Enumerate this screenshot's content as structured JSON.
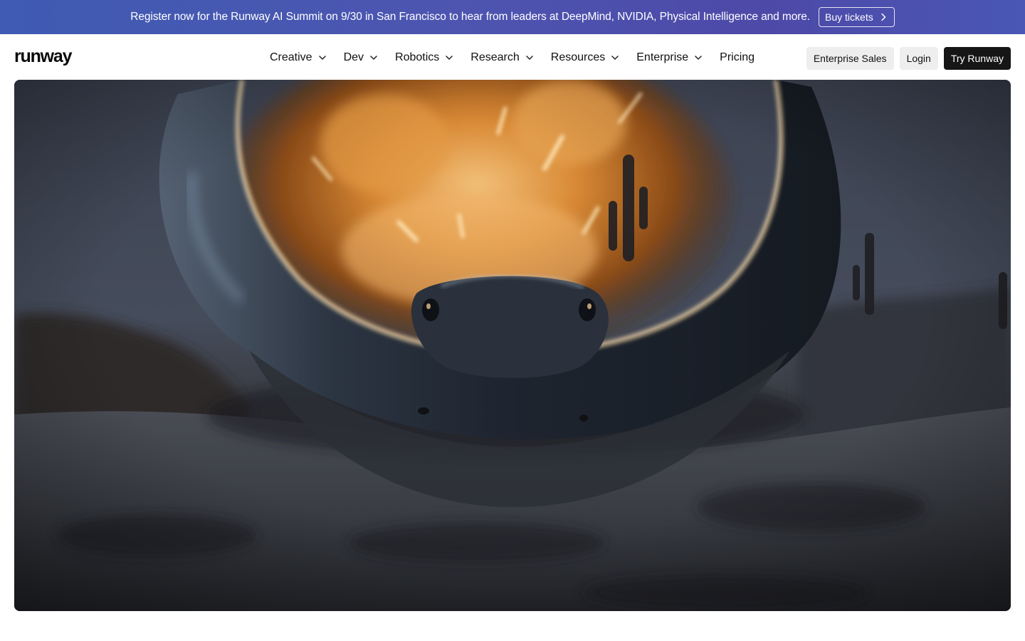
{
  "banner": {
    "text": "Register now for the Runway AI Summit on 9/30 in San Francisco to hear from leaders at DeepMind, NVIDIA, Physical Intelligence and more.",
    "button_label": "Buy tickets",
    "button_icon": "chevron-right-icon"
  },
  "nav": {
    "logo": "runway",
    "links": [
      {
        "label": "Creative",
        "has_dropdown": true
      },
      {
        "label": "Dev",
        "has_dropdown": true
      },
      {
        "label": "Robotics",
        "has_dropdown": true
      },
      {
        "label": "Research",
        "has_dropdown": true
      },
      {
        "label": "Resources",
        "has_dropdown": true
      },
      {
        "label": "Enterprise",
        "has_dropdown": true
      },
      {
        "label": "Pricing",
        "has_dropdown": false
      }
    ],
    "actions": {
      "enterprise_sales": "Enterprise Sales",
      "login": "Login",
      "try": "Try Runway"
    }
  },
  "hero": {
    "media": "video-still: desert scene with a large stingray-like creature in the foreground, explosion with sparks and cacti in the background"
  },
  "colors": {
    "banner_start": "#3f5bb3",
    "banner_end": "#4a57b5",
    "primary_button": "#161616",
    "secondary_button": "#eeeeee"
  }
}
